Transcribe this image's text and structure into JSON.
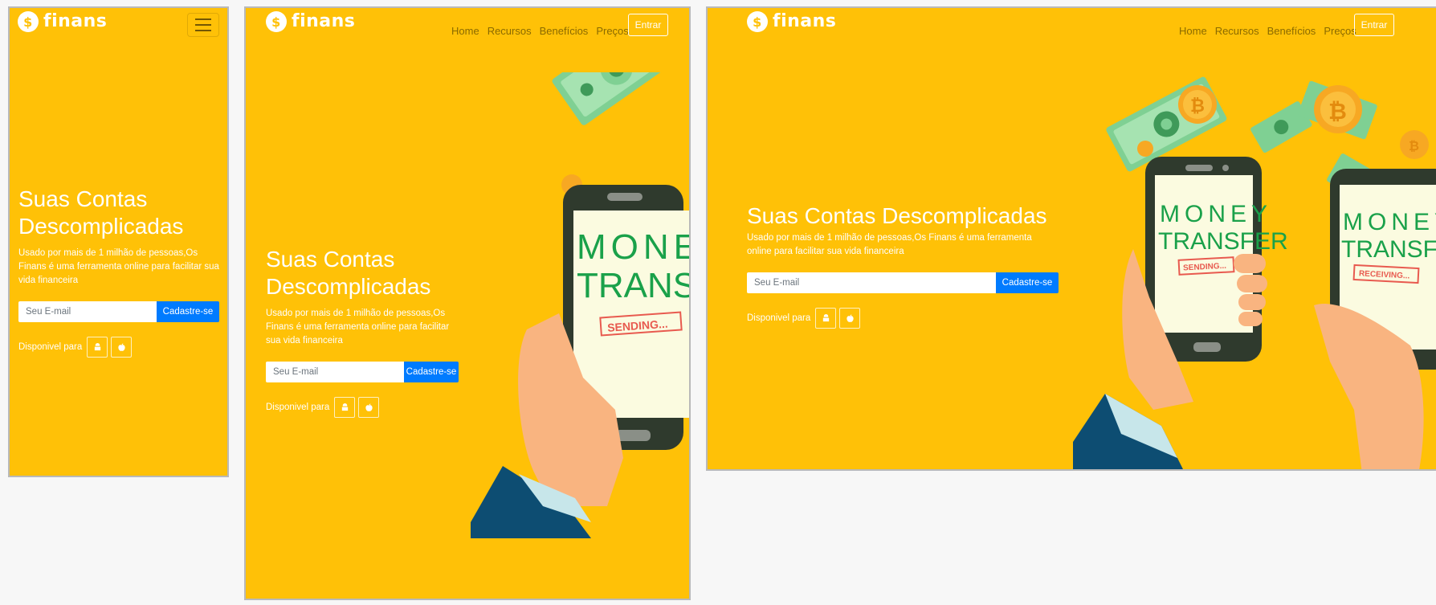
{
  "brand": {
    "name": "finans",
    "coin_symbol": "$",
    "color_primary": "#ffc107",
    "color_button": "#007bff"
  },
  "nav": {
    "items": [
      "Home",
      "Recursos",
      "Benefícios",
      "Preços"
    ],
    "login_label": "Entrar"
  },
  "hero": {
    "title": "Suas Contas Descomplicadas",
    "description": "Usado por mais de 1 milhão de pessoas,Os Finans é uma ferramenta online para facilitar sua vida financeira",
    "email_placeholder": "Seu E-mail",
    "signup_label": "Cadastre-se",
    "available_label": "Disponivel para"
  },
  "illustration": {
    "phone_text_1": "MONEY",
    "phone_text_2": "TRANSFER",
    "status_sending": "SENDING...",
    "status_receiving": "RECEIVING..."
  },
  "icons": {
    "coin": "bitcoin-coin-icon",
    "android": "android-icon",
    "apple": "apple-icon"
  }
}
